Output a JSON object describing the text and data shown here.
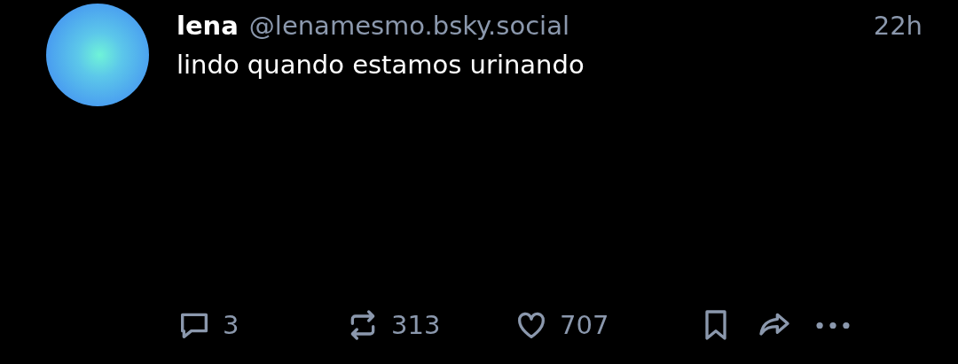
{
  "post": {
    "author": {
      "name": "lena",
      "handle": "@lenamesmo.bsky.social"
    },
    "time": "22h",
    "text": "lindo quando estamos urinando",
    "actions": [
      {
        "kind": "reply",
        "count": "3"
      },
      {
        "kind": "repost",
        "count": "313"
      },
      {
        "kind": "like",
        "count": "707"
      },
      {
        "kind": "bookmark"
      },
      {
        "kind": "share"
      },
      {
        "kind": "more"
      }
    ]
  }
}
